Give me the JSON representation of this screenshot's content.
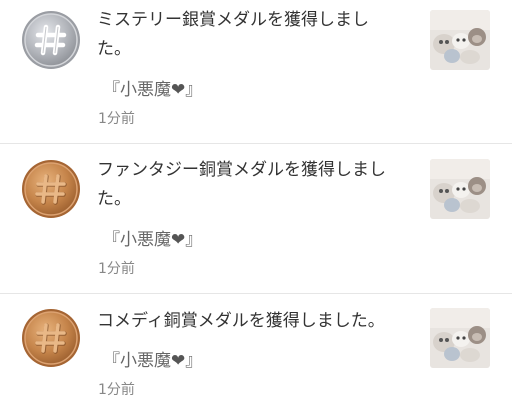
{
  "notifications": [
    {
      "medal": "silver",
      "medal_icon": "hash-icon",
      "message": "ミステリー銀賞メダルを獲得しました。",
      "title_open": "『小悪魔",
      "title_heart": "❤",
      "title_close": "』",
      "time": "1分前",
      "thumbnail": "plush-toys-photo"
    },
    {
      "medal": "bronze",
      "medal_icon": "hash-icon",
      "message": "ファンタジー銅賞メダルを獲得しました。",
      "title_open": "『小悪魔",
      "title_heart": "❤",
      "title_close": "』",
      "time": "1分前",
      "thumbnail": "plush-toys-photo"
    },
    {
      "medal": "bronze",
      "medal_icon": "hash-icon",
      "message": "コメディ銅賞メダルを獲得しました。",
      "title_open": "『小悪魔",
      "title_heart": "❤",
      "title_close": "』",
      "time": "1分前",
      "thumbnail": "plush-toys-photo"
    }
  ],
  "colors": {
    "silver_medal": "#b9bcc2",
    "bronze_medal": "#c98a4b",
    "divider": "#e6e6e6",
    "time_text": "#888888"
  }
}
